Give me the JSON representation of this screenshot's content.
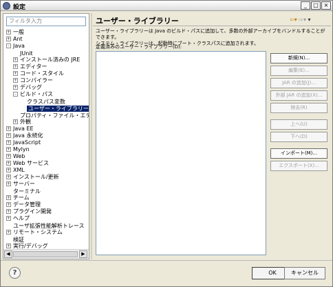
{
  "window": {
    "title": "設定"
  },
  "left": {
    "filter_placeholder": "フィルタ入力",
    "tree": [
      {
        "label": "一般",
        "expander": "+"
      },
      {
        "label": "Ant",
        "expander": "+"
      },
      {
        "label": "Java",
        "expander": "-"
      },
      {
        "label": "JUnit",
        "expander": ""
      },
      {
        "label": "インストール済みの JRE",
        "expander": "+"
      },
      {
        "label": "エディター",
        "expander": "+"
      },
      {
        "label": "コード・スタイル",
        "expander": "+"
      },
      {
        "label": "コンパイラー",
        "expander": "+"
      },
      {
        "label": "デバッグ",
        "expander": "+"
      },
      {
        "label": "ビルド・パス",
        "expander": "-"
      },
      {
        "label": "クラスパス変数",
        "expander": ""
      },
      {
        "label": "ユーザー・ライブラリー",
        "expander": "",
        "selected": true
      },
      {
        "label": "プロパティ・ファイル・エディタ",
        "expander": ""
      },
      {
        "label": "外観",
        "expander": "+"
      },
      {
        "label": "Java EE",
        "expander": "+"
      },
      {
        "label": "Java 永続化",
        "expander": "+"
      },
      {
        "label": "JavaScript",
        "expander": "+"
      },
      {
        "label": "Mylyn",
        "expander": "+"
      },
      {
        "label": "Web",
        "expander": "+"
      },
      {
        "label": "Web サービス",
        "expander": "+"
      },
      {
        "label": "XML",
        "expander": "+"
      },
      {
        "label": "インストール/更新",
        "expander": "+"
      },
      {
        "label": "サーバー",
        "expander": "+"
      },
      {
        "label": "ターミナル",
        "expander": ""
      },
      {
        "label": "チーム",
        "expander": "+"
      },
      {
        "label": "データ管理",
        "expander": "+"
      },
      {
        "label": "プラグイン開発",
        "expander": "+"
      },
      {
        "label": "ヘルプ",
        "expander": "+"
      },
      {
        "label": "ユーザ拡張性能解析トレース",
        "expander": ""
      },
      {
        "label": "リモート・システム",
        "expander": "+"
      },
      {
        "label": "検証",
        "expander": ""
      },
      {
        "label": "実行/デバッグ",
        "expander": "+"
      }
    ]
  },
  "right": {
    "title": "ユーザー・ライブラリー",
    "description_line1": "ユーザー・ライブラリーは Java のビルド・パスに追加して、多数の外部アーカイブをバンドルすることができます。",
    "description_line2": "システム・ライブラリーは、起動時にブート・クラスパスに追加されます。",
    "list_label": "定義済みのユーザー・ライブラリー(D):",
    "buttons": [
      {
        "label": "新規(N)...",
        "enabled": true
      },
      {
        "label": "編集(E)...",
        "enabled": false
      },
      {
        "label": "JAR の追加(J)...",
        "enabled": false
      },
      {
        "label": "外部 JAR の追加(X)...",
        "enabled": false
      },
      {
        "label": "除去(R)",
        "enabled": false
      },
      {
        "label": "上へ(U)",
        "enabled": false
      },
      {
        "label": "下へ(D)",
        "enabled": false
      },
      {
        "label": "インポート(M)...",
        "enabled": true
      },
      {
        "label": "エクスポート(X)...",
        "enabled": false
      }
    ]
  },
  "footer": {
    "ok_label": "OK",
    "cancel_label": "キャンセル"
  },
  "icons": {
    "window": "window-icon",
    "help": "help-icon",
    "back": "back-arrow-icon",
    "forward": "forward-arrow-icon",
    "menu": "menu-chevron-icon"
  }
}
